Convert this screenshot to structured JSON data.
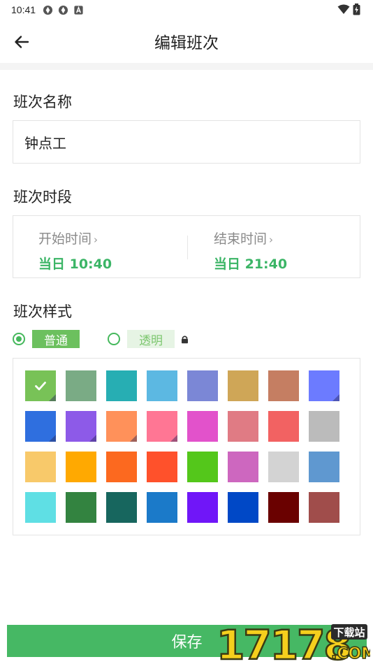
{
  "status_bar": {
    "time": "10:41",
    "left_icons": [
      "app-icon",
      "app-icon",
      "notification-icon"
    ],
    "right_icons": [
      "wifi-icon",
      "battery-icon"
    ]
  },
  "app_bar": {
    "back_icon": "arrow-left-icon",
    "title": "编辑班次"
  },
  "shift_name": {
    "label": "班次名称",
    "value": "钟点工"
  },
  "shift_period": {
    "label": "班次时段",
    "start": {
      "caption": "开始时间",
      "value": "当日 10:40"
    },
    "end": {
      "caption": "结束时间",
      "value": "当日 21:40"
    }
  },
  "shift_style": {
    "label": "班次样式",
    "options": [
      {
        "label": "普通",
        "selected": true
      },
      {
        "label": "透明",
        "selected": false,
        "locked": true
      }
    ],
    "accent_color": "#45b85c",
    "selected_color_index": 0,
    "colors": [
      "#78c257",
      "#7aab85",
      "#27aeb3",
      "#5cb8e2",
      "#7b87d6",
      "#cfa657",
      "#c57e62",
      "#6c7bff",
      "#2f6fdf",
      "#8d5ae8",
      "#ff915a",
      "#ff7694",
      "#e252cb",
      "#e07b84",
      "#f26262",
      "#bbbbbb",
      "#f8c96a",
      "#ffa901",
      "#fc691f",
      "#ff512b",
      "#54c71b",
      "#cd67bf",
      "#d3d3d3",
      "#5f98d0",
      "#5fdfe4",
      "#338340",
      "#17665e",
      "#1b7ac9",
      "#7016f8",
      "#0048c6",
      "#6a0100",
      "#a04d4b"
    ]
  },
  "save_button": {
    "label": "保存"
  },
  "watermark": {
    "brand": "17178",
    "sub": "下载站",
    "domain": ".COM"
  }
}
